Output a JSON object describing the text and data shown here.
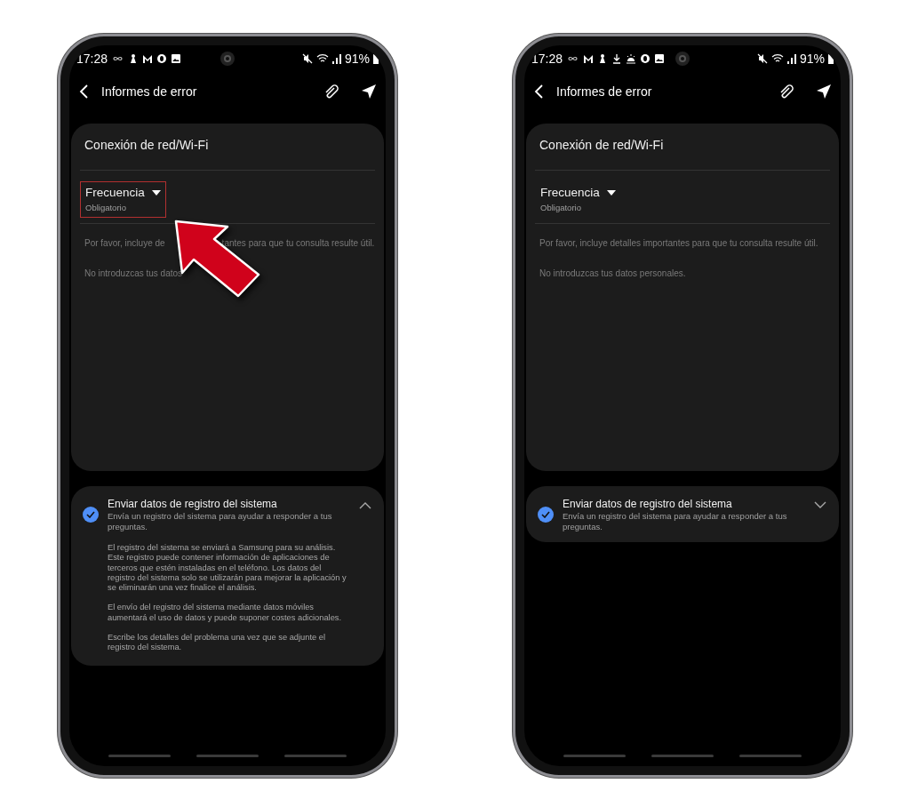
{
  "phones": [
    {
      "status_bar": {
        "time": "17:28",
        "notifications": [
          {
            "kind": "infinity"
          },
          {
            "kind": "person"
          },
          {
            "kind": "mail"
          },
          {
            "kind": "circle"
          },
          {
            "kind": "image"
          }
        ],
        "battery": "91%"
      },
      "header": {
        "title": "Informes de error"
      },
      "form": {
        "category": "Conexión de red/Wi-Fi",
        "frequency": {
          "label": "Frecuencia",
          "hint": "Obligatorio",
          "highlighted": true
        },
        "hint_lines": [
          {
            "segments": [
              "Por favor, incluye de",
              "tantes para que tu consulta resulte útil."
            ]
          },
          {
            "segments": [
              "No introduzcas tus datos"
            ]
          }
        ]
      },
      "log_option": {
        "title": "Enviar datos de registro del sistema",
        "subtitle": "Envía un registro del sistema para ayudar a responder a tus preguntas.",
        "checked": true,
        "expanded": true,
        "details": [
          "El registro del sistema se enviará a Samsung para su análisis. Este registro puede contener información de aplicaciones de terceros que estén instaladas en el teléfono. Los datos del registro del sistema solo se utilizarán para mejorar la aplicación y se eliminarán una vez finalice el análisis.",
          "El envío del registro del sistema mediante datos móviles aumentará el uso de datos y puede suponer costes adicionales.",
          "Escribe los detalles del problema una vez que se adjunte el registro del sistema."
        ]
      },
      "arrow_annotation": true
    },
    {
      "status_bar": {
        "time": "17:28",
        "notifications": [
          {
            "kind": "infinity"
          },
          {
            "kind": "mail"
          },
          {
            "kind": "person"
          },
          {
            "kind": "download"
          },
          {
            "kind": "sun"
          },
          {
            "kind": "circle"
          },
          {
            "kind": "image"
          }
        ],
        "battery": "91%"
      },
      "header": {
        "title": "Informes de error"
      },
      "form": {
        "category": "Conexión de red/Wi-Fi",
        "frequency": {
          "label": "Frecuencia",
          "hint": "Obligatorio",
          "highlighted": false
        },
        "hint_lines": [
          {
            "segments": [
              "Por favor, incluye detalles importantes para que tu consulta resulte útil."
            ]
          },
          {
            "segments": [
              "No introduzcas tus datos personales."
            ]
          }
        ]
      },
      "log_option": {
        "title": "Enviar datos de registro del sistema",
        "subtitle": "Envía un registro del sistema para ayudar a responder a tus preguntas.",
        "checked": true,
        "expanded": false
      },
      "arrow_annotation": false
    }
  ]
}
